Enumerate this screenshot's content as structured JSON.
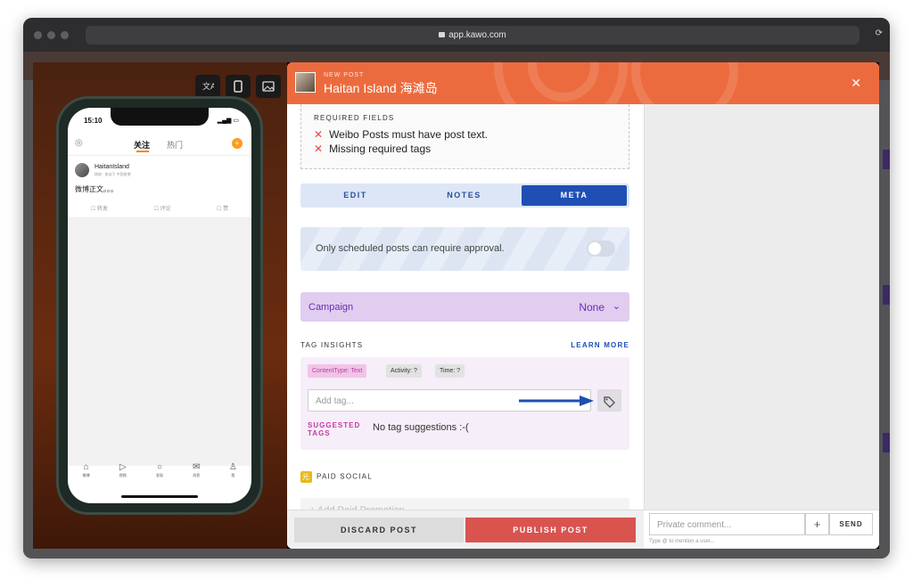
{
  "browser": {
    "url": "app.kawo.com"
  },
  "preview": {
    "icons": [
      "translate-icon",
      "phone-icon",
      "image-icon"
    ],
    "phone": {
      "time": "15:10",
      "tab_following": "关注",
      "tab_hot": "热门",
      "post": {
        "username": "HaitanIsland",
        "meta": "刚刚 · 来自于 中国香港",
        "text": "微博正文。。。",
        "actions": [
          "转发",
          "评论",
          "赞"
        ]
      },
      "nav": [
        "微博",
        "视频",
        "发现",
        "消息",
        "我"
      ]
    }
  },
  "modal": {
    "kicker": "NEW POST",
    "title": "Haitan Island 海滩岛",
    "required_fields": {
      "title": "REQUIRED FIELDS",
      "items": [
        "Weibo Posts must have post text.",
        "Missing required tags"
      ]
    },
    "tabs": [
      "EDIT",
      "NOTES",
      "META"
    ],
    "active_tab": "META",
    "approval_text": "Only scheduled posts can require approval.",
    "approval_enabled": false,
    "campaign": {
      "label": "Campaign",
      "value": "None"
    },
    "tag_insights": {
      "title": "TAG INSIGHTS",
      "learn_more": "LEARN MORE",
      "chips": [
        "ContentType: Text",
        "Activity: ?",
        "Time: ?"
      ],
      "input_placeholder": "Add tag...",
      "suggested_label": "SUGGESTED TAGS",
      "suggested_text": "No tag suggestions :-("
    },
    "paid_social": {
      "icon": "元",
      "title": "PAID SOCIAL",
      "add_label": "+ Add Paid Promotion"
    },
    "footer": {
      "discard": "DISCARD POST",
      "publish": "PUBLISH POST"
    },
    "comment": {
      "placeholder": "Private comment...",
      "plus": "+",
      "send": "SEND",
      "hint": "Type @ to mention a user..."
    }
  },
  "colors": {
    "header_orange": "#ec6b3e",
    "meta_blue": "#1f4fb5",
    "campaign_purple": "#6a2db0",
    "publish_red": "#d9534f",
    "arrow_blue": "#1e4fb0"
  }
}
